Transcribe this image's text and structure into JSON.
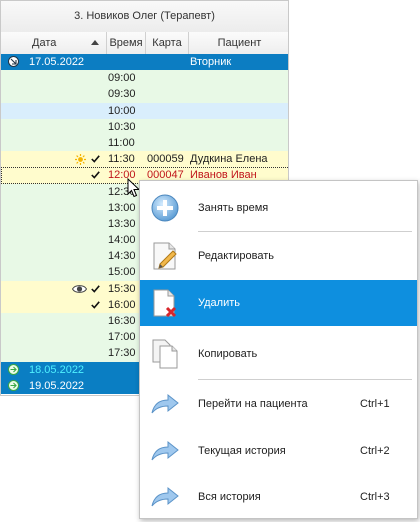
{
  "panel": {
    "title": "3. Новиков Олег (Терапевт)",
    "columns": {
      "date": "Дата",
      "time": "Время",
      "card": "Карта",
      "patient": "Пациент"
    }
  },
  "day1": {
    "date": "17.05.2022",
    "weekday": "Вторник"
  },
  "slots": [
    {
      "time": "09:00",
      "card": "",
      "patient": "",
      "style": "a"
    },
    {
      "time": "09:30",
      "card": "",
      "patient": "",
      "style": "a"
    },
    {
      "time": "10:00",
      "card": "",
      "patient": "",
      "style": "b"
    },
    {
      "time": "10:30",
      "card": "",
      "patient": "",
      "style": "a"
    },
    {
      "time": "11:00",
      "card": "",
      "patient": "",
      "style": "a"
    },
    {
      "time": "11:30",
      "card": "000059",
      "patient": "Дудкина Елена",
      "style": "yellow",
      "sun": true,
      "check": true
    },
    {
      "time": "12:00",
      "card": "000047",
      "patient": "Иванов Иван",
      "style": "yellow",
      "check": true,
      "red": true,
      "focused": true
    },
    {
      "time": "12:30",
      "card": "",
      "patient": "",
      "style": "a"
    },
    {
      "time": "13:00",
      "card": "",
      "patient": "",
      "style": "a"
    },
    {
      "time": "13:30",
      "card": "",
      "patient": "",
      "style": "a"
    },
    {
      "time": "14:00",
      "card": "",
      "patient": "",
      "style": "a"
    },
    {
      "time": "14:30",
      "card": "",
      "patient": "",
      "style": "a"
    },
    {
      "time": "15:00",
      "card": "",
      "patient": "",
      "style": "a"
    },
    {
      "time": "15:30",
      "card": "",
      "patient": "",
      "style": "yellow",
      "eye": true,
      "check": true
    },
    {
      "time": "16:00",
      "card": "",
      "patient": "",
      "style": "yellow",
      "check": true
    },
    {
      "time": "16:30",
      "card": "",
      "patient": "",
      "style": "a"
    },
    {
      "time": "17:00",
      "card": "",
      "patient": "",
      "style": "a"
    },
    {
      "time": "17:30",
      "card": "",
      "patient": "",
      "style": "a"
    }
  ],
  "day2": {
    "date": "18.05.2022"
  },
  "day3": {
    "date": "19.05.2022"
  },
  "menu": {
    "items": [
      {
        "label": "Занять время",
        "shortcut": ""
      },
      {
        "label": "Редактировать",
        "shortcut": ""
      },
      {
        "label": "Удалить",
        "shortcut": ""
      },
      {
        "label": "Копировать",
        "shortcut": ""
      },
      {
        "label": "Перейти на пациента",
        "shortcut": "Ctrl+1"
      },
      {
        "label": "Текущая история",
        "shortcut": "Ctrl+2"
      },
      {
        "label": "Вся история",
        "shortcut": "Ctrl+3"
      }
    ]
  },
  "colors": {
    "accent": "#0e8fdf",
    "dayhead": "#0c7dc2",
    "rowGreen": "#e8f9e6",
    "rowBlue": "#d9eefc",
    "rowYellow": "#fffccd",
    "red": "#c0151a"
  }
}
